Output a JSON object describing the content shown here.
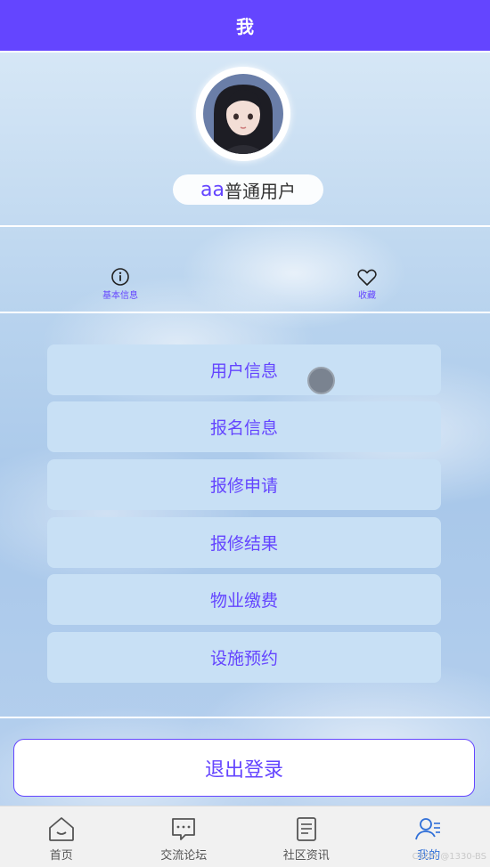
{
  "header": {
    "title": "我"
  },
  "profile": {
    "username": "aa",
    "role": "普通用户"
  },
  "quick_actions": [
    {
      "label": "基本信息",
      "icon": "info-icon"
    },
    {
      "label": "收藏",
      "icon": "heart-icon"
    }
  ],
  "menu": [
    {
      "label": "用户信息"
    },
    {
      "label": "报名信息"
    },
    {
      "label": "报修申请"
    },
    {
      "label": "报修结果"
    },
    {
      "label": "物业缴费"
    },
    {
      "label": "设施预约"
    }
  ],
  "logout": {
    "label": "退出登录"
  },
  "tabbar": [
    {
      "label": "首页",
      "icon": "home-icon"
    },
    {
      "label": "交流论坛",
      "icon": "chat-icon"
    },
    {
      "label": "社区资讯",
      "icon": "document-icon"
    },
    {
      "label": "我的",
      "icon": "user-icon",
      "active": true
    }
  ],
  "watermark": "CSDN @1330-BS",
  "colors": {
    "accent": "#6445ff",
    "active_tab": "#2f6fd8",
    "menu_bg": "#c8e0f5"
  }
}
